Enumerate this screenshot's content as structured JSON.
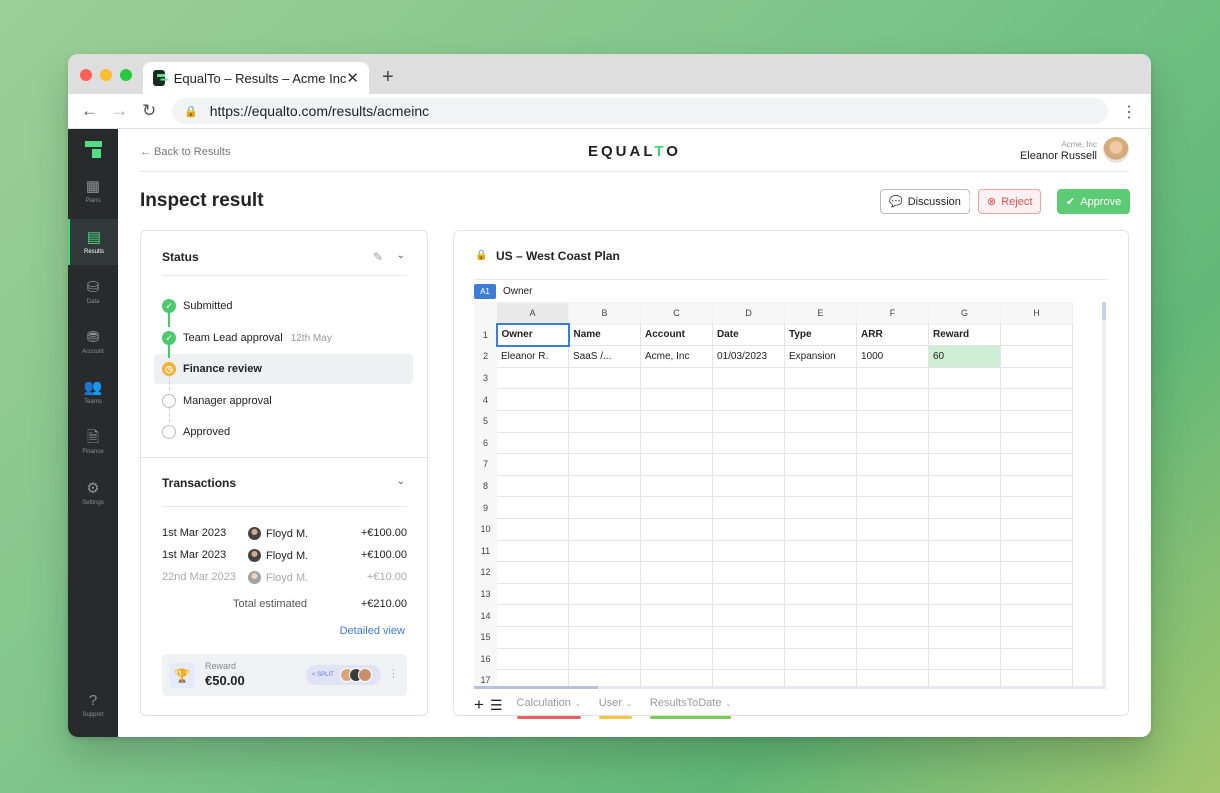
{
  "browser": {
    "tab_title": "EqualTo – Results – Acme Inc",
    "tab_close": "✕",
    "new_tab": "+",
    "url": "https://equalto.com/results/acmeinc"
  },
  "sidebar": {
    "items": [
      {
        "label": "Plans",
        "icon": "grid-icon",
        "glyph": "▦"
      },
      {
        "label": "Results",
        "icon": "table-icon",
        "glyph": "▤",
        "active": true
      },
      {
        "label": "Data",
        "icon": "database-icon",
        "glyph": "⛁"
      },
      {
        "label": "Account",
        "icon": "coins-icon",
        "glyph": "⛃"
      },
      {
        "label": "Teams",
        "icon": "people-icon",
        "glyph": "👥"
      },
      {
        "label": "Finance",
        "icon": "document-icon",
        "glyph": "🗎"
      },
      {
        "label": "Settings",
        "icon": "gears-icon",
        "glyph": "⚙"
      },
      {
        "label": "Support",
        "icon": "question-icon",
        "glyph": "?"
      }
    ]
  },
  "header": {
    "back_link": "← Back to Results",
    "brand": "EQUAL",
    "brand_accent": "T",
    "brand_end": "O",
    "user_org": "Acme, Inc",
    "user_name": "Eleanor Russell"
  },
  "page": {
    "title": "Inspect result",
    "discussion_label": "Discussion",
    "reject_label": "Reject",
    "approve_label": "Approve"
  },
  "status": {
    "title": "Status",
    "steps": [
      {
        "label": "Submitted",
        "state": "done",
        "date": ""
      },
      {
        "label": "Team Lead approval",
        "state": "done",
        "date": "12th May"
      },
      {
        "label": "Finance review",
        "state": "pending",
        "date": ""
      },
      {
        "label": "Manager approval",
        "state": "todo",
        "date": ""
      },
      {
        "label": "Approved",
        "state": "todo",
        "date": ""
      }
    ]
  },
  "transactions": {
    "title": "Transactions",
    "rows": [
      {
        "date": "1st Mar 2023",
        "who": "Floyd M.",
        "amount": "+€100.00",
        "muted": false
      },
      {
        "date": "1st Mar 2023",
        "who": "Floyd M.",
        "amount": "+€100.00",
        "muted": false
      },
      {
        "date": "22nd Mar 2023",
        "who": "Floyd M.",
        "amount": "+€10.00",
        "muted": true
      }
    ],
    "total_label": "Total estimated",
    "total_value": "+€210.00",
    "detail_link": "Detailed view"
  },
  "reward": {
    "label": "Reward",
    "value": "€50.00",
    "split_label": "< SPLIT"
  },
  "spreadsheet": {
    "plan_title": "US – West Coast Plan",
    "cell_ref": "A1",
    "cell_value": "Owner",
    "columns": [
      "A",
      "B",
      "C",
      "D",
      "E",
      "F",
      "G",
      "H"
    ],
    "rows": [
      [
        "Owner",
        "Name",
        "Account",
        "Date",
        "Type",
        "ARR",
        "Reward",
        ""
      ],
      [
        "Eleanor R.",
        "SaaS  /...",
        "Acme, Inc",
        "01/03/2023",
        "Expansion",
        "1000",
        "60",
        ""
      ]
    ],
    "row_count": 17,
    "tabs": [
      {
        "label": "Calculation",
        "color": "#e86060"
      },
      {
        "label": "User",
        "color": "#f5c443"
      },
      {
        "label": "ResultsToDate",
        "color": "#7cc95a"
      }
    ]
  }
}
